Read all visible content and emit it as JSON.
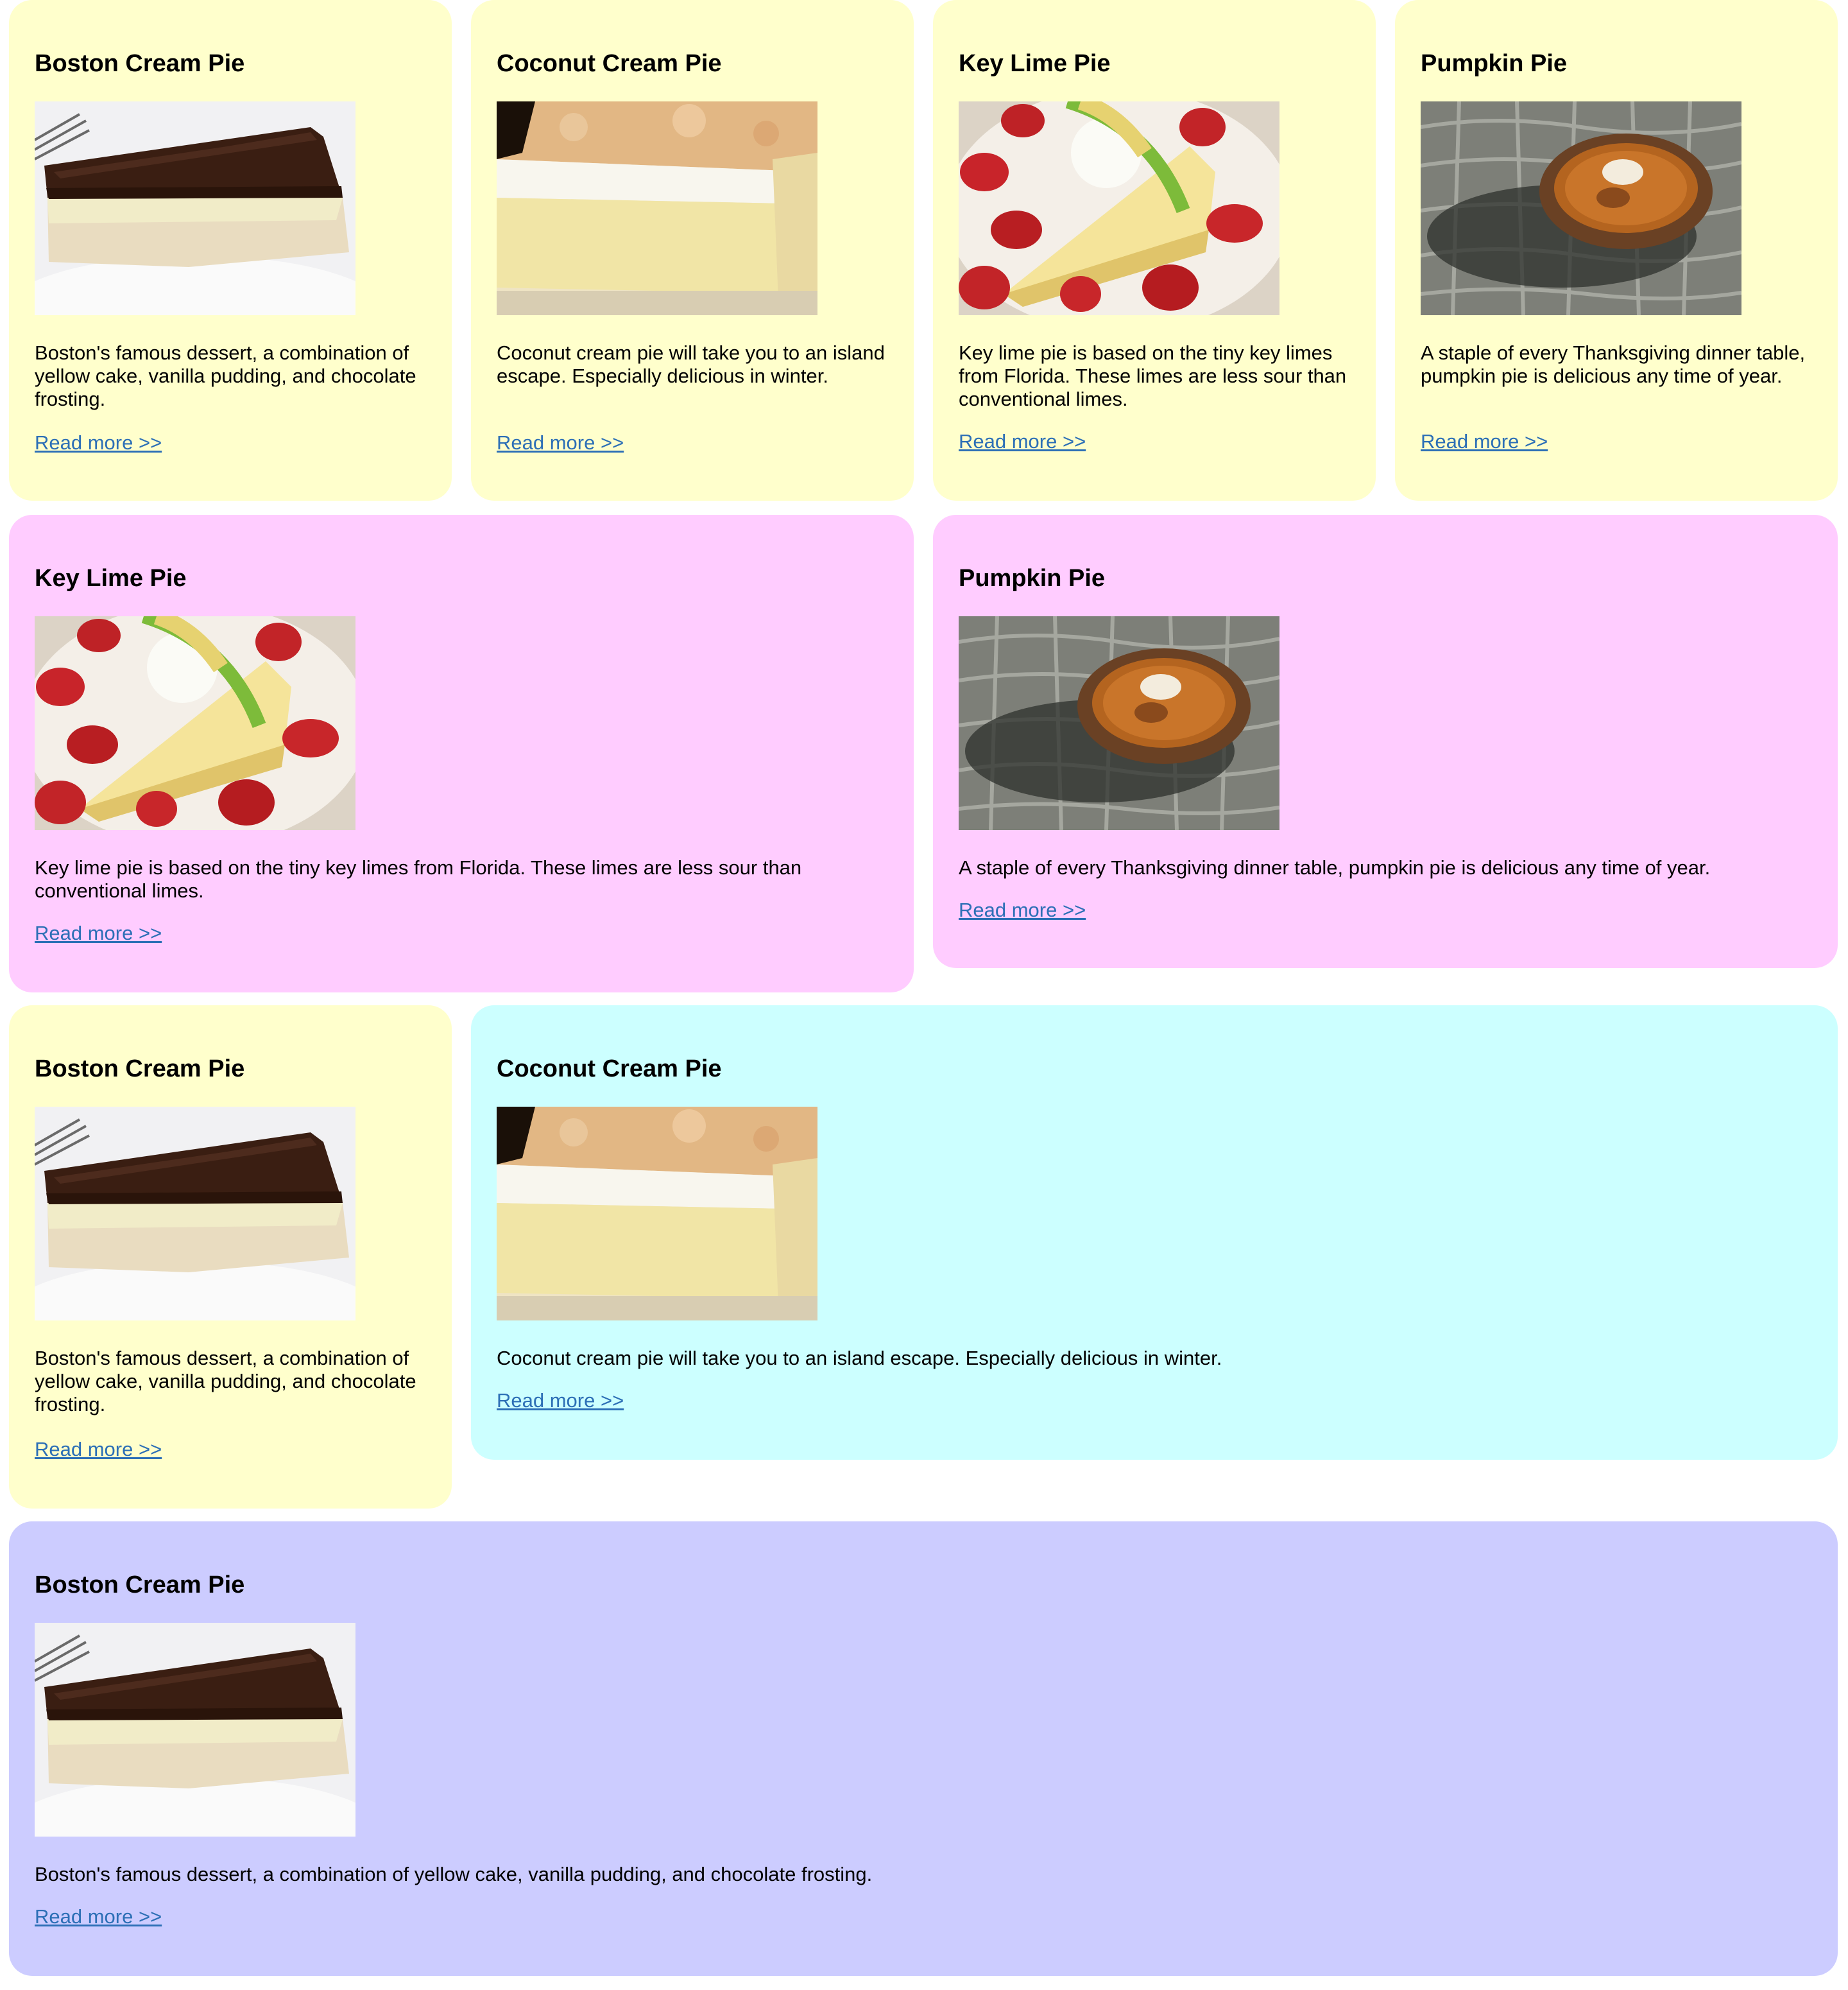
{
  "colors": {
    "yellow": "#ffffcc",
    "pink": "#ffccff",
    "cyan": "#ccffff",
    "lavender": "#ccccff",
    "link": "#2c6fb6"
  },
  "read_more": "Read more >>",
  "pies": {
    "boston": {
      "title": "Boston Cream Pie",
      "desc": "Boston's famous dessert, a combination of yellow cake, vanilla pudding, and chocolate frosting.",
      "image": "boston-cream-pie-slice-photo"
    },
    "coconut": {
      "title": "Coconut Cream Pie",
      "desc": "Coconut cream pie will take you to an island escape. Especially delicious in winter.",
      "image": "coconut-cream-pie-slice-photo"
    },
    "keylime": {
      "title": "Key Lime Pie",
      "desc": "Key lime pie is based on the tiny key limes from Florida. These limes are less sour than conventional limes.",
      "image": "key-lime-pie-with-strawberries-photo"
    },
    "pumpkin": {
      "title": "Pumpkin Pie",
      "desc": "A staple of every Thanksgiving dinner table, pumpkin pie is delicious any time of year.",
      "image": "pumpkin-pie-on-cobblestone-photo"
    }
  }
}
